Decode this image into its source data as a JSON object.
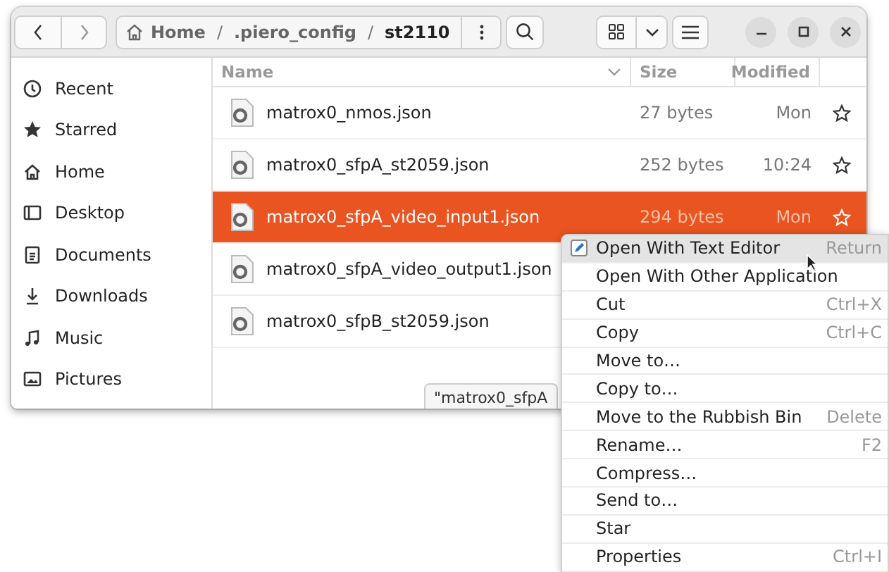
{
  "window": {
    "path": {
      "separator": "/",
      "segments": [
        {
          "label": "Home",
          "kind": "home",
          "current": false
        },
        {
          "label": ".piero_config",
          "kind": "folder",
          "current": false
        },
        {
          "label": "st2110",
          "kind": "folder",
          "current": true
        }
      ]
    }
  },
  "sidebar": {
    "items": [
      {
        "label": "Recent",
        "kind": "recent",
        "selected": false
      },
      {
        "label": "Starred",
        "kind": "starred",
        "selected": false
      },
      {
        "label": "Home",
        "kind": "home",
        "selected": false
      },
      {
        "label": "Desktop",
        "kind": "desktop",
        "selected": false
      },
      {
        "label": "Documents",
        "kind": "documents",
        "selected": false
      },
      {
        "label": "Downloads",
        "kind": "downloads",
        "selected": false
      },
      {
        "label": "Music",
        "kind": "music",
        "selected": false
      },
      {
        "label": "Pictures",
        "kind": "pictures",
        "selected": false
      }
    ]
  },
  "table": {
    "columns": [
      "Name",
      "Size",
      "Modified"
    ],
    "rows": [
      {
        "name": "matrox0_nmos.json",
        "size": "27 bytes",
        "modified": "Mon",
        "starred": false,
        "selected": false
      },
      {
        "name": "matrox0_sfpA_st2059.json",
        "size": "252 bytes",
        "modified": "10:24",
        "starred": false,
        "selected": false
      },
      {
        "name": "matrox0_sfpA_video_input1.json",
        "size": "294 bytes",
        "modified": "Mon",
        "starred": false,
        "selected": true
      },
      {
        "name": "matrox0_sfpA_video_output1.json",
        "selected": false
      },
      {
        "name": "matrox0_sfpB_st2059.json",
        "selected": false
      }
    ]
  },
  "status_popup": {
    "text": "\"matrox0_sfpA"
  },
  "context_menu": {
    "items": [
      {
        "label": "Open With Text Editor",
        "shortcut": "Return",
        "selected": true,
        "has_icon": true
      },
      {
        "label": "Open With Other Application",
        "selected": false,
        "has_icon": false
      },
      {
        "label": "Cut",
        "shortcut": "Ctrl+X",
        "selected": false,
        "has_icon": false
      },
      {
        "label": "Copy",
        "shortcut": "Ctrl+C",
        "selected": false,
        "has_icon": false
      },
      {
        "label": "Move to…",
        "selected": false,
        "has_icon": false
      },
      {
        "label": "Copy to…",
        "selected": false,
        "has_icon": false
      },
      {
        "label": "Move to the Rubbish Bin",
        "shortcut": "Delete",
        "selected": false,
        "has_icon": false
      },
      {
        "label": "Rename…",
        "shortcut": "F2",
        "selected": false,
        "has_icon": false
      },
      {
        "label": "Compress…",
        "selected": false,
        "has_icon": false
      },
      {
        "label": "Send to…",
        "selected": false,
        "has_icon": false
      },
      {
        "label": "Star",
        "selected": false,
        "has_icon": false
      },
      {
        "label": "Properties",
        "shortcut": "Ctrl+I",
        "selected": false,
        "has_icon": false
      }
    ]
  }
}
